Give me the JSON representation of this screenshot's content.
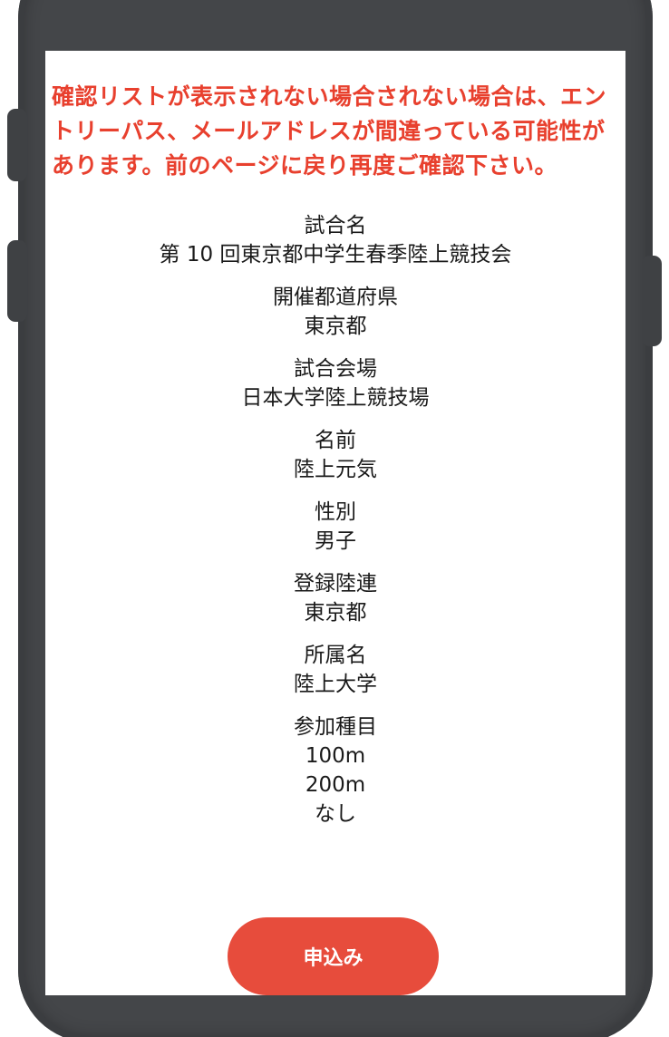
{
  "warning_text": "確認リストが表示されない場合されない場合は、エントリーパス、メールアドレスが間違っている可能性があります。前のページに戻り再度ご確認下さい。",
  "fields": [
    {
      "label": "試合名",
      "value": "第 10 回東京都中学生春季陸上競技会"
    },
    {
      "label": "開催都道府県",
      "value": "東京都"
    },
    {
      "label": "試合会場",
      "value": "日本大学陸上競技場"
    },
    {
      "label": "名前",
      "value": "陸上元気"
    },
    {
      "label": "性別",
      "value": "男子"
    },
    {
      "label": "登録陸連",
      "value": "東京都"
    },
    {
      "label": "所属名",
      "value": "陸上大学"
    }
  ],
  "events": {
    "label": "参加種目",
    "items": [
      "100m",
      "200m",
      "なし"
    ]
  },
  "apply_button": "申込み",
  "colors": {
    "warning": "#e8402e",
    "button": "#e74c3c",
    "phone_body": "#444649"
  }
}
